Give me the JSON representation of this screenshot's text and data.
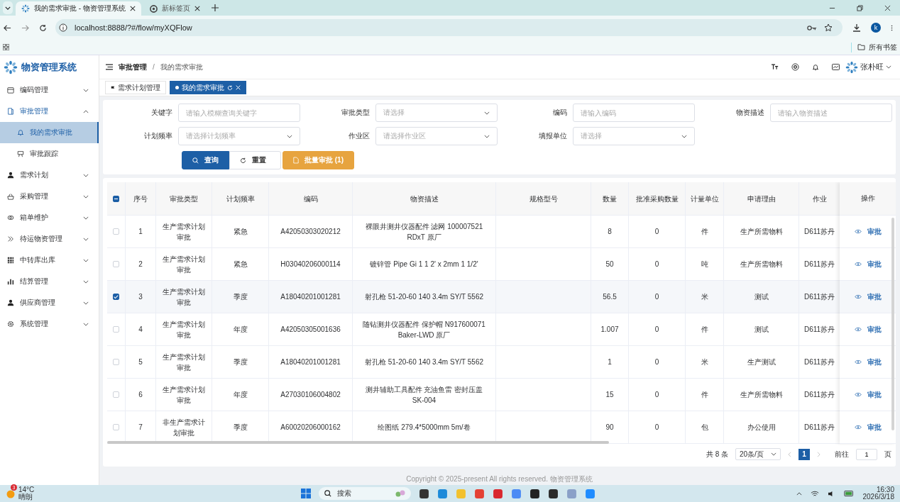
{
  "browser": {
    "tabs": [
      {
        "title": "我的需求审批 - 物资管理系统",
        "selected": true
      },
      {
        "title": "新标签页",
        "selected": false
      }
    ],
    "url": "localhost:8888/?#/flow/myXQFlow",
    "profile": "k",
    "bookmarks_label": "所有书签"
  },
  "app": {
    "name": "物资管理系统"
  },
  "sidebar": {
    "items": [
      {
        "label": "编码管理",
        "expanded": false
      },
      {
        "label": "审批管理",
        "expanded": true,
        "children": [
          {
            "label": "我的需求审批",
            "selected": true
          },
          {
            "label": "审批跟踪",
            "selected": false
          }
        ]
      },
      {
        "label": "需求计划",
        "expanded": false
      },
      {
        "label": "采购管理",
        "expanded": false
      },
      {
        "label": "箱单维护",
        "expanded": false
      },
      {
        "label": "待运物资管理",
        "expanded": false
      },
      {
        "label": "中转库出库",
        "expanded": false
      },
      {
        "label": "结算管理",
        "expanded": false
      },
      {
        "label": "供应商管理",
        "expanded": false
      },
      {
        "label": "系统管理",
        "expanded": false
      }
    ]
  },
  "header": {
    "breadcrumb": [
      "审批管理",
      "我的需求审批"
    ],
    "breadcrumb_separator": "/",
    "user": "张朴旺"
  },
  "page_tabs": [
    {
      "label": "需求计划管理",
      "selected": false
    },
    {
      "label": "我的需求审批",
      "selected": true
    }
  ],
  "filters": [
    {
      "label": "关键字",
      "kind": "input",
      "placeholder": "请输入模糊查询关键字"
    },
    {
      "label": "审批类型",
      "kind": "select",
      "placeholder": "请选择"
    },
    {
      "label": "编码",
      "kind": "input",
      "placeholder": "请输入编码"
    },
    {
      "label": "物资描述",
      "kind": "input",
      "placeholder": "请输入物资描述"
    },
    {
      "label": "计划频率",
      "kind": "select",
      "placeholder": "请选择计划频率"
    },
    {
      "label": "作业区",
      "kind": "select",
      "placeholder": "请选择作业区"
    },
    {
      "label": "填报单位",
      "kind": "select",
      "placeholder": "请选择"
    }
  ],
  "buttons": [
    {
      "label": "查询",
      "kind": "primary"
    },
    {
      "label": "重置",
      "kind": "default"
    },
    {
      "label": "批量审批 (1)",
      "kind": "warning"
    }
  ],
  "table": {
    "select_all": {
      "indeterminate": true
    },
    "columns": [
      "序号",
      "审批类型",
      "计划频率",
      "编码",
      "物资描述",
      "规格型号",
      "数量",
      "批准采购数量",
      "计量单位",
      "申请理由",
      "作业",
      "操作"
    ],
    "rows": [
      {
        "checked": false,
        "cells": [
          "1",
          "生产需求计划审批",
          "紧急",
          "A42050303020212",
          "裸眼井测井仪器配件 滤网 100007521 RDxT 原厂",
          "",
          "8",
          "0",
          "件",
          "生产所需物料",
          "D611苏丹"
        ],
        "action": "审批"
      },
      {
        "checked": false,
        "cells": [
          "2",
          "生产需求计划审批",
          "紧急",
          "H03040206000114",
          "镀锌管 Pipe Gi 1 1 2' x 2mm 1 1/2'",
          "",
          "50",
          "0",
          "吨",
          "生产所需物料",
          "D611苏丹"
        ],
        "action": "审批"
      },
      {
        "checked": true,
        "cells": [
          "3",
          "生产需求计划审批",
          "季度",
          "A18040201001281",
          "射孔枪 51-20-60 140 3.4m SY/T 5562",
          "",
          "56.5",
          "0",
          "米",
          "测试",
          "D611苏丹"
        ],
        "action": "审批"
      },
      {
        "checked": false,
        "cells": [
          "4",
          "生产需求计划审批",
          "年度",
          "A42050305001636",
          "随钻测井仪器配件 保护帽 N917600071 Baker-LWD 原厂",
          "",
          "1.007",
          "0",
          "件",
          "测试",
          "D611苏丹"
        ],
        "action": "审批"
      },
      {
        "checked": false,
        "cells": [
          "5",
          "生产需求计划审批",
          "季度",
          "A18040201001281",
          "射孔枪 51-20-60 140 3.4m SY/T 5562",
          "",
          "1",
          "0",
          "米",
          "生产测试",
          "D611苏丹"
        ],
        "action": "审批"
      },
      {
        "checked": false,
        "cells": [
          "6",
          "生产需求计划审批",
          "年度",
          "A27030106004802",
          "测井辅助工具配件 充油鱼雷 密封压盖 SK-004",
          "",
          "15",
          "0",
          "件",
          "生产所需物料",
          "D611苏丹"
        ],
        "action": "审批"
      },
      {
        "checked": false,
        "cells": [
          "7",
          "非生产需求计划审批",
          "季度",
          "A60020206000162",
          "绘图纸 279.4*5000mm 5m/卷",
          "",
          "90",
          "0",
          "包",
          "办公使用",
          "D611苏丹"
        ],
        "action": "审批"
      }
    ]
  },
  "pagination": {
    "total": "共 8 条",
    "page_size": "20条/页",
    "pages": [
      {
        "label": "1",
        "selected": true
      }
    ],
    "goto_label": "前往",
    "goto_value": "1",
    "goto_suffix": "页"
  },
  "footer": "Copyright © 2025-present All rights reserved. 物资管理系统",
  "taskbar": {
    "weather_badge": "3",
    "temperature": "14°C",
    "condition": "晴朗",
    "search": "搜索",
    "time": "16:30",
    "date": "2026/3/18"
  }
}
